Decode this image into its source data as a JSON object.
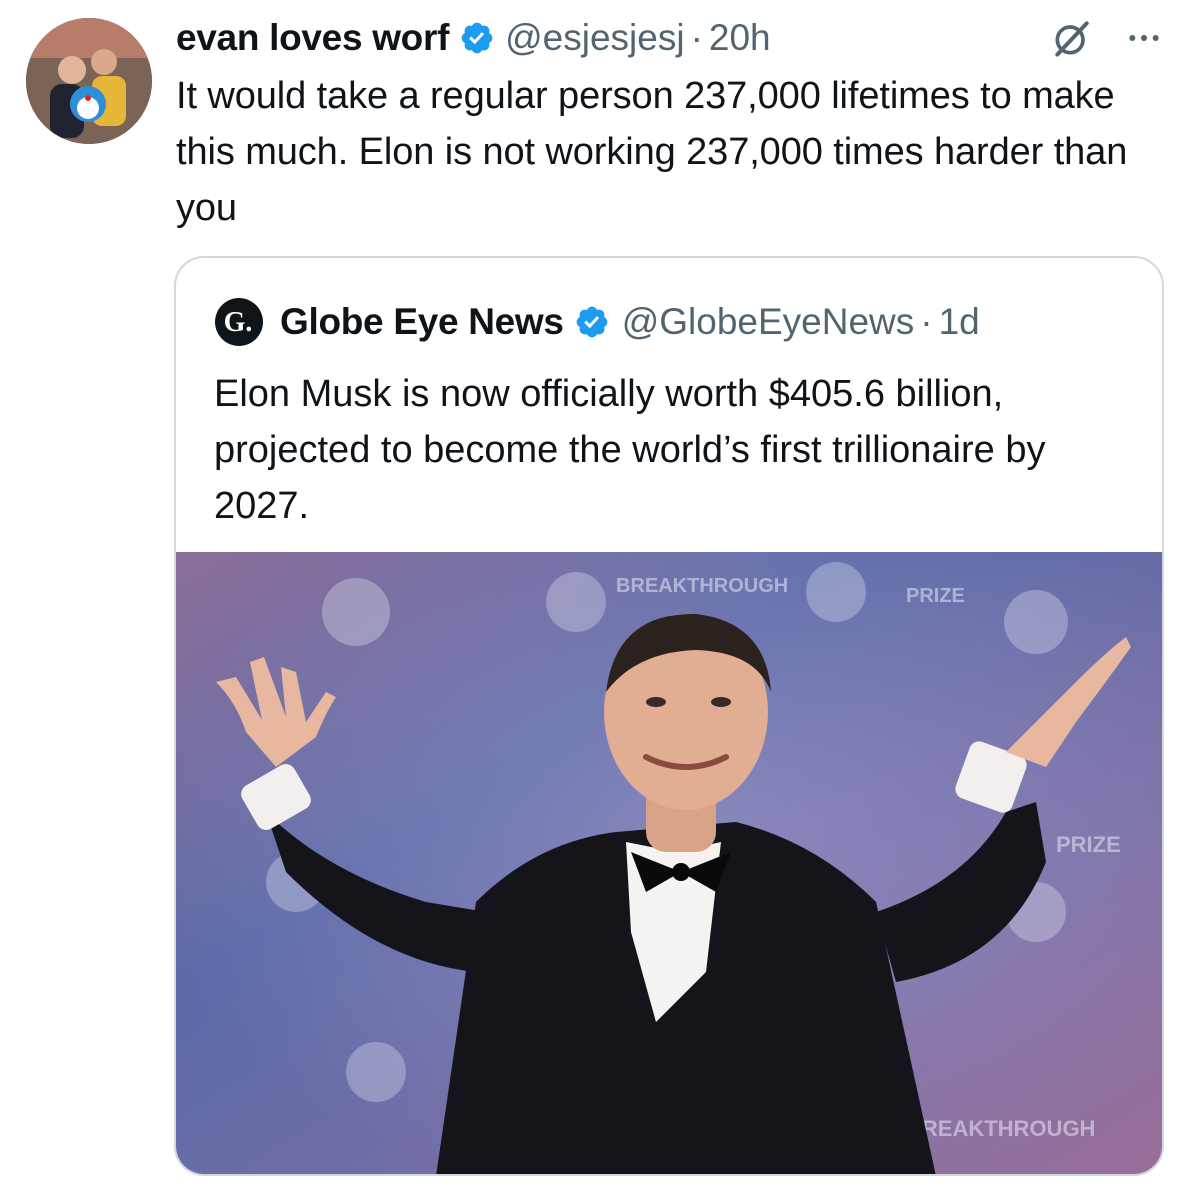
{
  "tweet": {
    "display_name": "evan loves worf",
    "handle": "@esjesjesj",
    "separator": "·",
    "time": "20h",
    "text": "It would take a regular person 237,000 lifetimes to make this much. Elon is not working 237,000 times harder than you",
    "avatar": "user-avatar-photo",
    "verified_icon": "verified-badge-icon",
    "actions": {
      "grok_icon": "grok-icon",
      "more_icon": "more-options-icon"
    }
  },
  "quote": {
    "display_name": "Globe Eye News",
    "handle": "@GlobeEyeNews",
    "separator": "·",
    "time": "1d",
    "logo_letter": "G.",
    "text": "Elon Musk is now officially worth $405.6 billion, projected to become the world’s first trillionaire by 2027.",
    "media": "photo-man-in-tuxedo-arms-raised",
    "backdrop_text": [
      "BREAKTHROUGH",
      "PRIZE"
    ]
  },
  "colors": {
    "text": "#0f1419",
    "secondary": "#536471",
    "verified": "#1d9bf0",
    "border": "#cfd9de",
    "backdrop": "#6f6a9e"
  }
}
